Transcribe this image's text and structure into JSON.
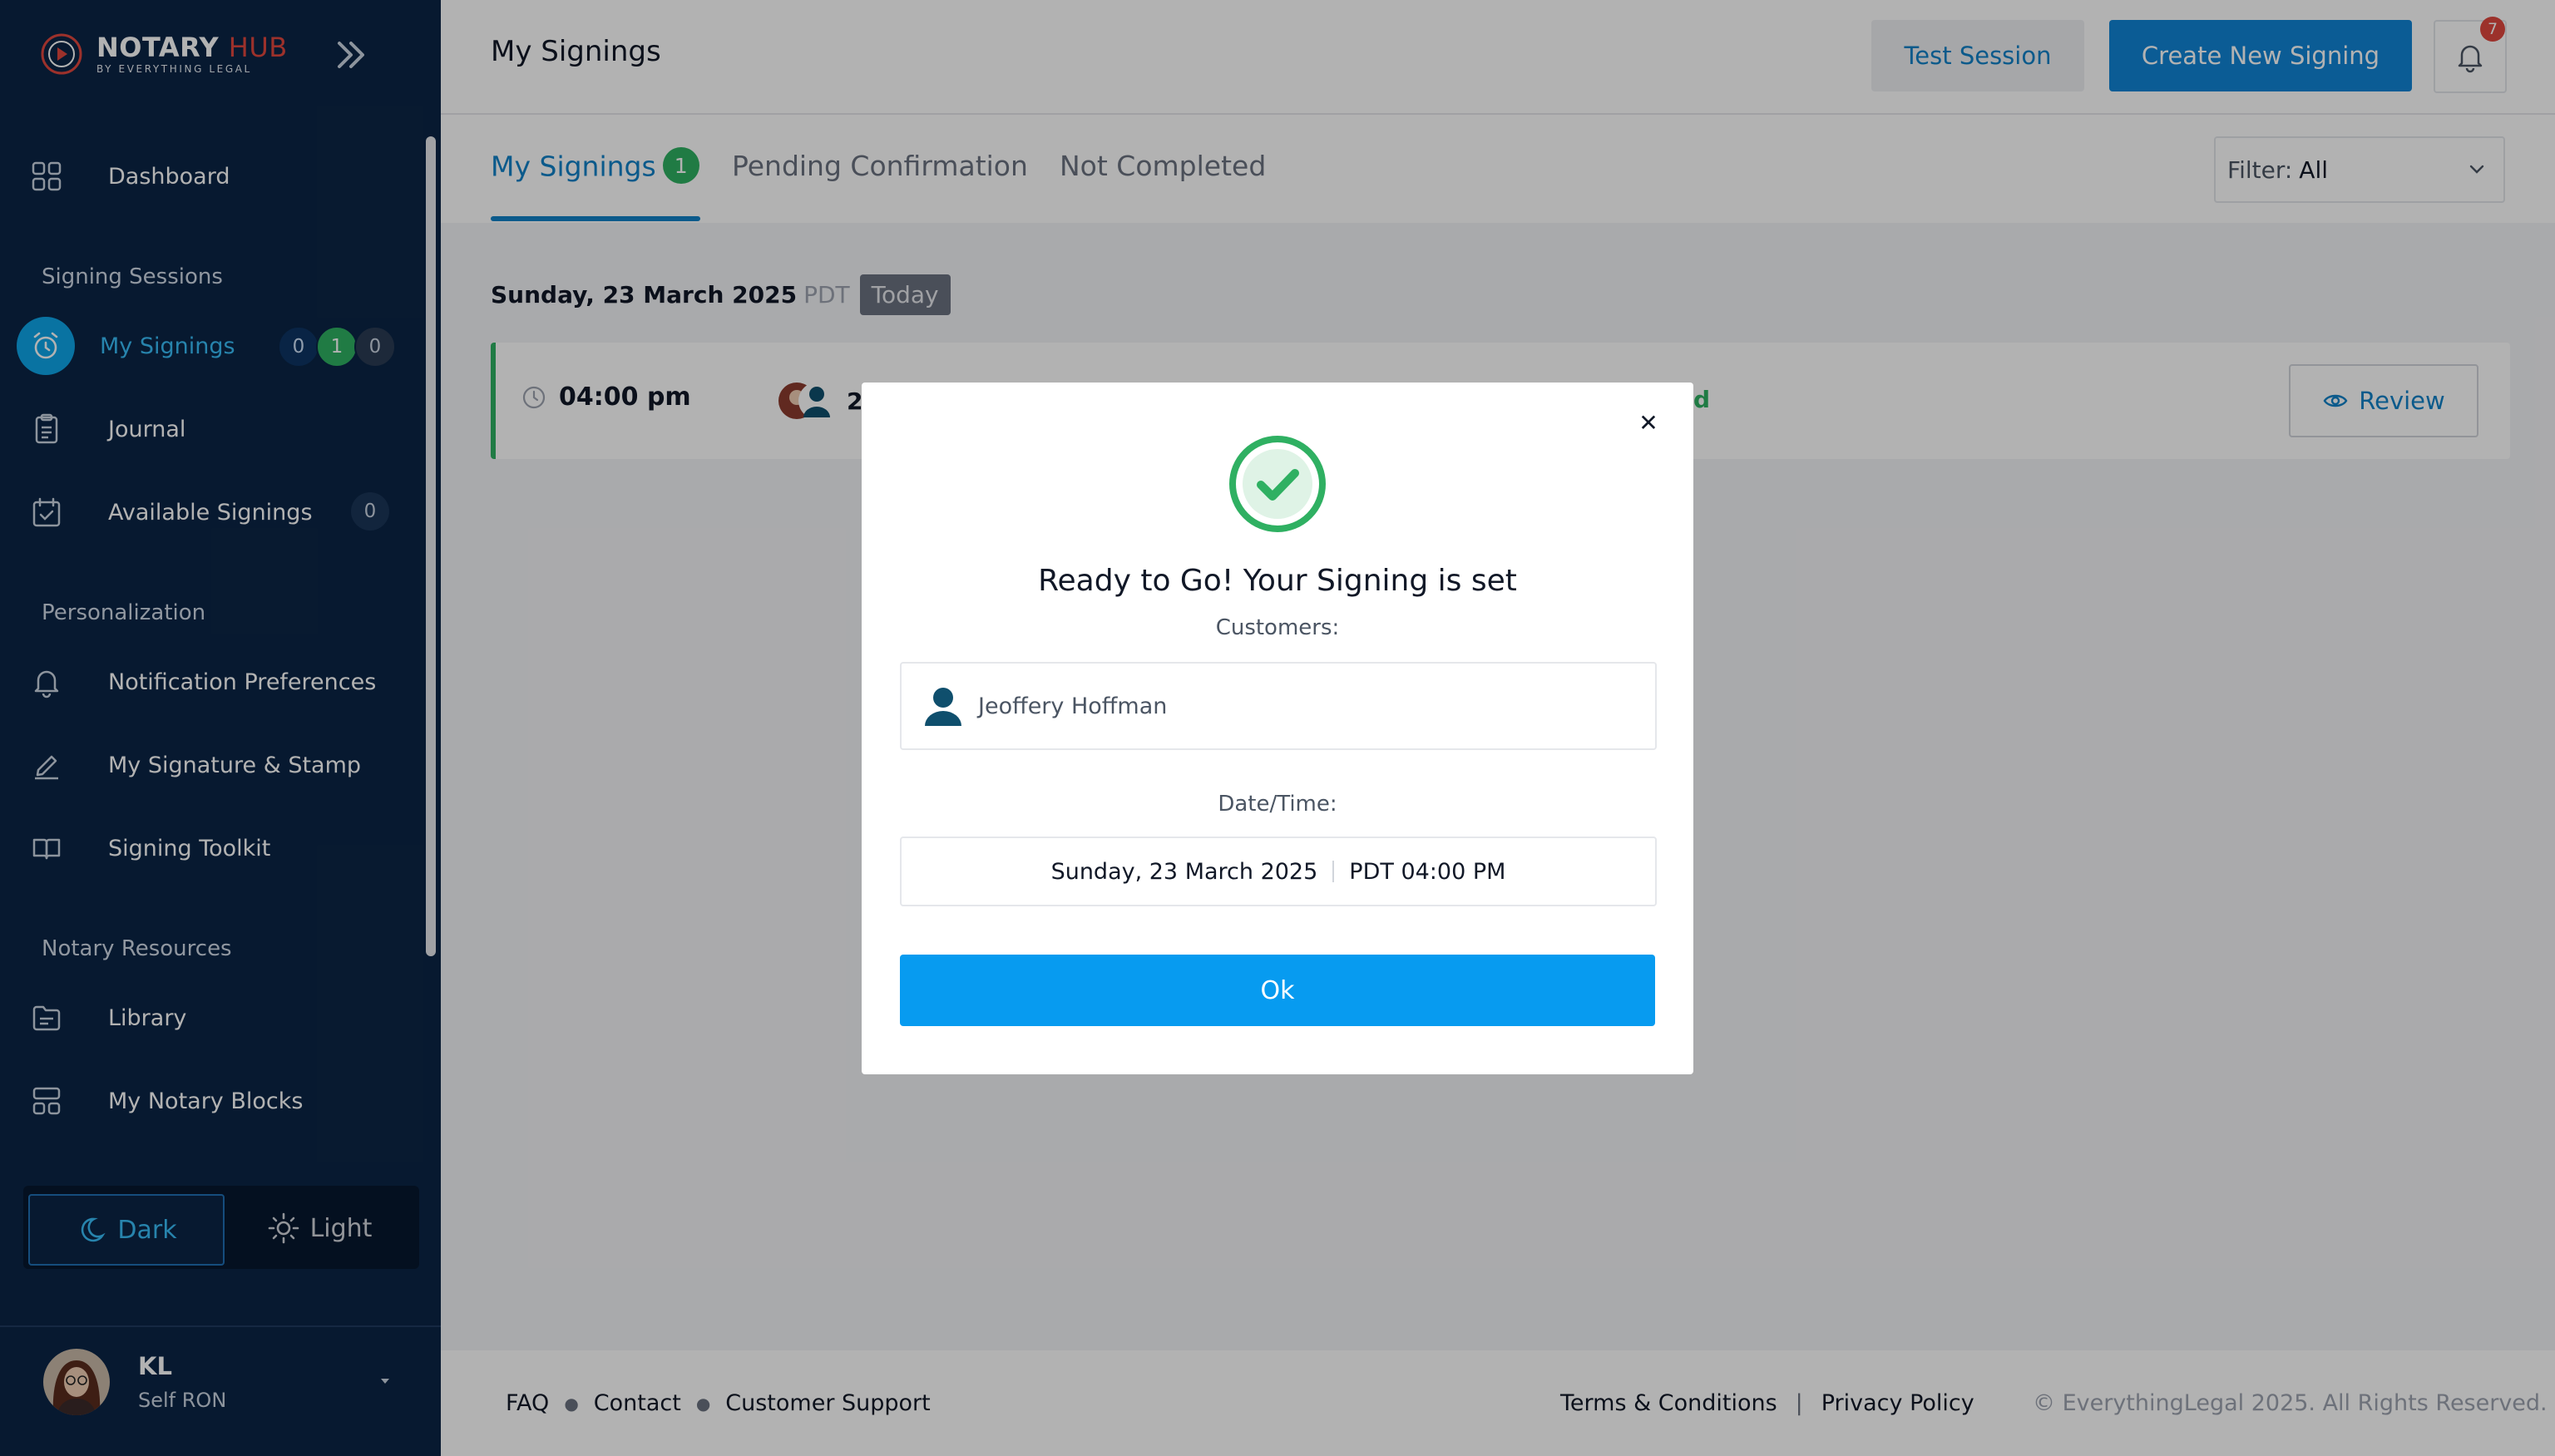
{
  "brand": {
    "name_part1": "NOTARY",
    "name_part2": "HUB",
    "tagline": "BY EVERYTHING LEGAL"
  },
  "sidebar": {
    "dashboard": "Dashboard",
    "section_signing": "Signing Sessions",
    "my_signings": "My Signings",
    "my_signings_badges": [
      "0",
      "1",
      "0"
    ],
    "journal": "Journal",
    "available_signings": "Available Signings",
    "available_signings_count": "0",
    "section_personalization": "Personalization",
    "notification_prefs": "Notification Preferences",
    "signature_stamp": "My Signature & Stamp",
    "signing_toolkit": "Signing Toolkit",
    "section_resources": "Notary Resources",
    "library": "Library",
    "notary_blocks": "My Notary Blocks"
  },
  "theme": {
    "dark": "Dark",
    "light": "Light",
    "selected": "Dark"
  },
  "user": {
    "initials": "KL",
    "role": "Self RON"
  },
  "header": {
    "title": "My Signings",
    "test_session": "Test Session",
    "create_signing": "Create New Signing",
    "notification_count": "7"
  },
  "tabs": {
    "my_signings": "My Signings",
    "my_signings_count": "1",
    "pending": "Pending Confirmation",
    "not_completed": "Not Completed"
  },
  "filter": {
    "label": "Filter:",
    "value": "All"
  },
  "list": {
    "date": "Sunday, 23 March 2025",
    "timezone": "PDT",
    "today": "Today",
    "signing": {
      "time": "04:00 pm",
      "participants": "2",
      "status_partial": "d",
      "review": "Review"
    }
  },
  "footer": {
    "faq": "FAQ",
    "contact": "Contact",
    "support": "Customer Support",
    "terms": "Terms & Conditions",
    "privacy": "Privacy Policy",
    "copyright": "© EverythingLegal 2025. All Rights Reserved."
  },
  "modal": {
    "title": "Ready to Go! Your Signing is set",
    "customers_label": "Customers:",
    "customer_name": "Jeoffery Hoffman",
    "datetime_label": "Date/Time:",
    "date_value": "Sunday, 23 March 2025",
    "time_value": "PDT 04:00 PM",
    "ok": "Ok"
  },
  "colors": {
    "sidebar_bg": "#0b2545",
    "accent_blue": "#1185d6",
    "success_green": "#2fb062",
    "ok_button": "#079bf0",
    "alert_red": "#e0473e"
  }
}
